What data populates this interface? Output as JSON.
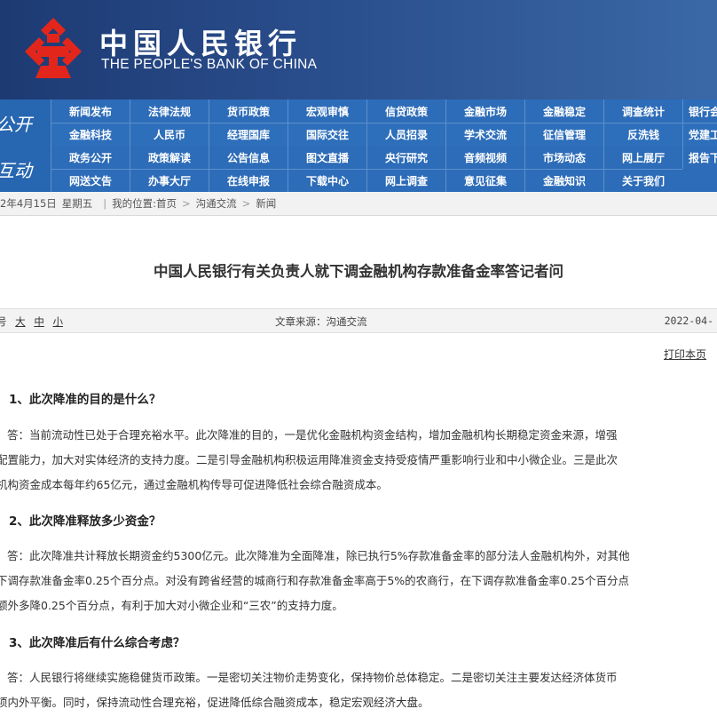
{
  "brand": {
    "name_cn": "中国人民银行",
    "name_en": "THE PEOPLE'S BANK OF CHINA",
    "logo_color": "#e3261b"
  },
  "nav_open": {
    "tag": "公开",
    "row1": [
      "新闻发布",
      "法律法规",
      "货币政策",
      "宏观审慎",
      "信贷政策",
      "金融市场",
      "金融稳定",
      "调查统计",
      "银行会"
    ],
    "row2": [
      "金融科技",
      "人民币",
      "经理国库",
      "国际交往",
      "人员招录",
      "学术交流",
      "征信管理",
      "反洗钱",
      "党建工"
    ]
  },
  "nav_interact": {
    "tag": "互动",
    "row1": [
      "政务公开",
      "政策解读",
      "公告信息",
      "图文直播",
      "央行研究",
      "音频视频",
      "市场动态",
      "网上展厅",
      "报告下"
    ],
    "row2": [
      "网送文告",
      "办事大厅",
      "在线申报",
      "下载中心",
      "网上调查",
      "意见征集",
      "金融知识",
      "关于我们"
    ]
  },
  "breadcrumb": {
    "date": "2年4月15日",
    "weekday": "星期五",
    "location_label": "我的位置:",
    "items": [
      "首页",
      "沟通交流",
      "新闻"
    ]
  },
  "article": {
    "title": "中国人民银行有关负责人就下调金融机构存款准备金率答记者问",
    "font_sizes": [
      "号",
      "大",
      "中",
      "小"
    ],
    "source": "文章来源：沟通交流",
    "date": "2022-04-",
    "print": "打印本页",
    "q1": "1、此次降准的目的是什么？",
    "a1": [
      "答：当前流动性已处于合理充裕水平。此次降准的目的，一是优化金融机构资金结构，增加金融机构长期稳定资金来源，增强",
      "配置能力，加大对实体经济的支持力度。二是引导金融机构积极运用降准资金支持受疫情严重影响行业和中小微企业。三是此次",
      "机构资金成本每年约65亿元，通过金融机构传导可促进降低社会综合融资成本。"
    ],
    "q2": "2、此次降准释放多少资金？",
    "a2": [
      "答：此次降准共计释放长期资金约5300亿元。此次降准为全面降准，除已执行5%存款准备金率的部分法人金融机构外，对其他",
      "下调存款准备金率0.25个百分点。对没有跨省经营的城商行和存款准备金率高于5%的农商行，在下调存款准备金率0.25个百分点",
      "额外多降0.25个百分点，有利于加大对小微企业和“三农”的支持力度。"
    ],
    "q3": "3、此次降准后有什么综合考虑？",
    "a3": [
      "答：人民银行将继续实施稳健货币政策。一是密切关注物价走势变化，保持物价总体稳定。二是密切关注主要发达经济体货币",
      "项内外平衡。同时，保持流动性合理充裕，促进降低综合融资成本，稳定宏观经济大盘。"
    ]
  }
}
